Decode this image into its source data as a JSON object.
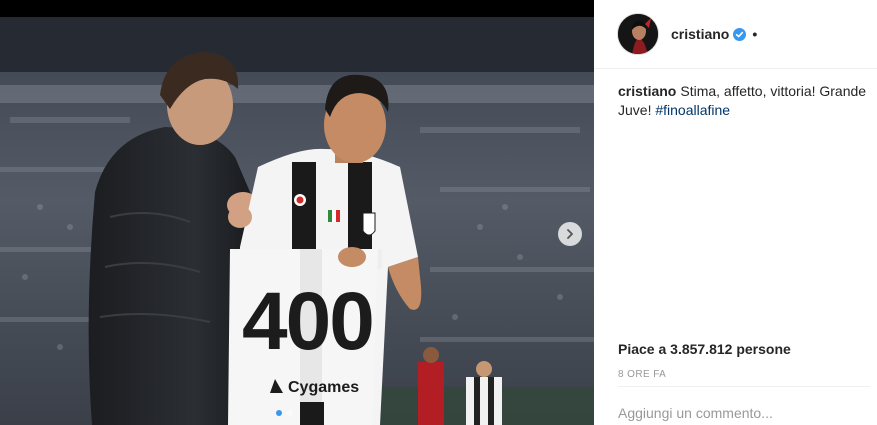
{
  "post": {
    "author": "cristiano",
    "separator": "•",
    "caption_text": "Stima, affetto, vittoria! Grande Juve! ",
    "hashtag": "#finoallafine",
    "likes_text": "Piace a 3.857.812 persone",
    "time_text": "8 ORE FA",
    "comment_placeholder": "Aggiungi un commento...",
    "carousel": {
      "total": 2,
      "current": 1
    }
  },
  "photo": {
    "jersey_number": "400",
    "sponsor": "Cygames"
  },
  "icons": {
    "verified": "verified-badge-icon",
    "next": "chevron-right-icon"
  },
  "colors": {
    "verified_blue": "#3897f0",
    "hashtag_blue": "#003569",
    "muted": "#999999"
  }
}
